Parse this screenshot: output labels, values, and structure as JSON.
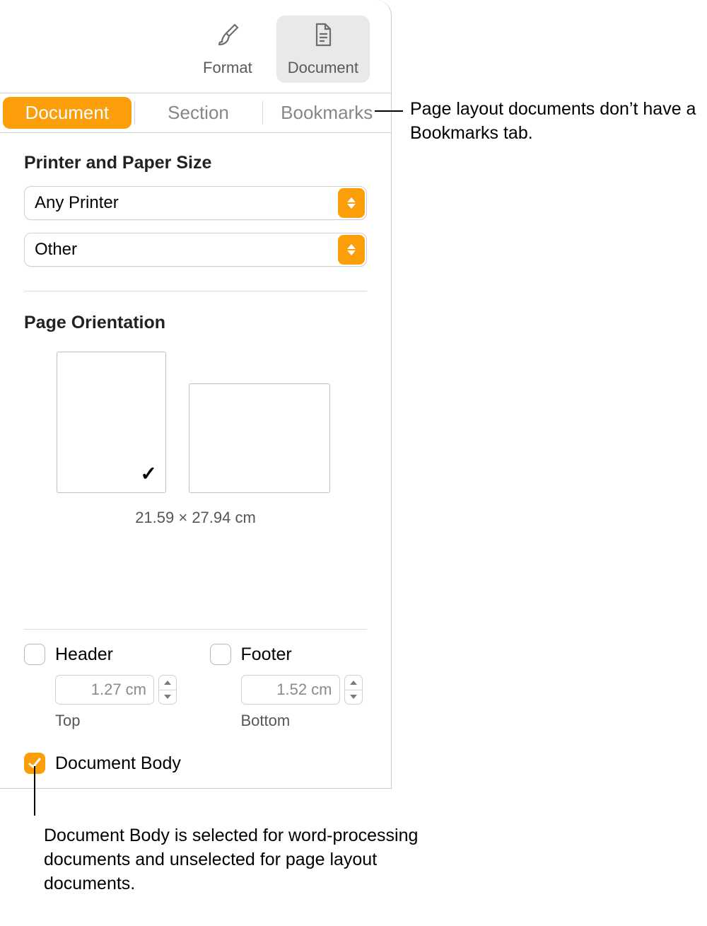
{
  "toolbar": {
    "format_label": "Format",
    "document_label": "Document"
  },
  "tabs": {
    "document": "Document",
    "section": "Section",
    "bookmarks": "Bookmarks"
  },
  "printer_paper": {
    "heading": "Printer and Paper Size",
    "printer_value": "Any Printer",
    "paper_value": "Other"
  },
  "orientation": {
    "heading": "Page Orientation",
    "size_text": "21.59 × 27.94 cm",
    "checkmark": "✓"
  },
  "hf": {
    "header_label": "Header",
    "footer_label": "Footer",
    "top_value": "1.27 cm",
    "bottom_value": "1.52 cm",
    "top_label": "Top",
    "bottom_label": "Bottom"
  },
  "doc_body": {
    "label": "Document Body"
  },
  "annotations": {
    "bookmarks": "Page layout documents don’t have a Bookmarks tab.",
    "body": "Document Body is selected for word-processing documents and unselected for page layout documents."
  }
}
